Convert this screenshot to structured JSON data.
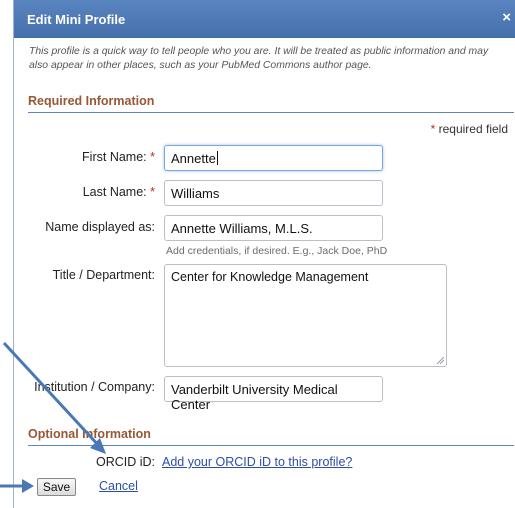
{
  "dialog": {
    "title": "Edit Mini Profile",
    "close_glyph": "×",
    "intro": "This profile is a quick way to tell people who you are. It will be treated as public information and may also appear in other places, such as your PubMed Commons author page."
  },
  "required_section": {
    "heading": "Required Information",
    "required_note": "required field",
    "star": "*",
    "first_name_label": "First Name:",
    "first_name_value": "Annette",
    "last_name_label": "Last Name:",
    "last_name_value": "Williams",
    "display_name_label": "Name displayed as:",
    "display_name_value": "Annette Williams, M.L.S.",
    "display_name_hint": "Add credentials, if desired. E.g., Jack Doe, PhD",
    "title_dept_label": "Title / Department:",
    "title_dept_value": "Center for Knowledge Management",
    "institution_label": "Institution / Company:",
    "institution_value": "Vanderbilt University Medical Center"
  },
  "optional_section": {
    "heading": "Optional Information",
    "orcid_label": "ORCID iD:",
    "orcid_link": "Add your ORCID iD to this profile?"
  },
  "actions": {
    "save_label": "Save",
    "cancel_label": "Cancel"
  },
  "colors": {
    "titlebar": "#4f79b4",
    "section_heading": "#985735",
    "link": "#2b4fa3",
    "required_star": "#c0292f",
    "annotation_arrow": "#4a78b5"
  }
}
